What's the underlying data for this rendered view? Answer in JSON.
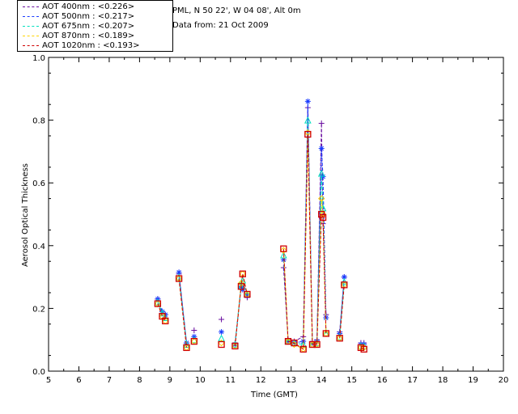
{
  "header": {
    "location": "PML, N 50 22', W 04 08', Alt 0m",
    "date": "Data from: 21 Oct 2009"
  },
  "legend": [
    {
      "label": "AOT  400nm : <0.226>",
      "color": "#6a0fa0"
    },
    {
      "label": "AOT  500nm : <0.217>",
      "color": "#1a3cff"
    },
    {
      "label": "AOT  675nm : <0.207>",
      "color": "#00e0c0"
    },
    {
      "label": "AOT  870nm : <0.189>",
      "color": "#ffd400"
    },
    {
      "label": "AOT 1020nm : <0.193>",
      "color": "#d00000"
    }
  ],
  "chart_data": {
    "type": "line",
    "xlabel": "Time (GMT)",
    "ylabel": "Aerosol Optical Thickness",
    "xlim": [
      5,
      20
    ],
    "ylim": [
      0.0,
      1.0
    ],
    "x_ticks": [
      "5",
      "6",
      "7",
      "8",
      "9",
      "10",
      "11",
      "12",
      "13",
      "14",
      "15",
      "16",
      "17",
      "18",
      "19",
      "20"
    ],
    "y_ticks": [
      "0.0",
      "0.2",
      "0.4",
      "0.6",
      "0.8",
      "1.0"
    ],
    "segments": [
      {
        "x": [
          8.6,
          8.75,
          8.85
        ]
      },
      {
        "x": [
          9.3,
          9.55
        ]
      },
      {
        "x": [
          9.8
        ]
      },
      {
        "x": [
          10.7
        ]
      },
      {
        "x": [
          11.15,
          11.35,
          11.4,
          11.55
        ]
      },
      {
        "x": [
          12.75,
          12.9,
          13.1,
          13.4,
          13.55,
          13.7,
          13.85,
          14.0,
          14.05,
          14.15
        ]
      },
      {
        "x": [
          14.6,
          14.75
        ]
      },
      {
        "x": [
          15.3,
          15.4
        ]
      }
    ],
    "series": [
      {
        "name": "AOT  400nm",
        "marker": "plus",
        "values": [
          [
            0.23,
            0.19,
            0.18
          ],
          [
            0.31,
            0.09
          ],
          [
            0.13
          ],
          [
            0.165
          ],
          [
            0.09,
            0.27,
            0.265,
            0.235
          ],
          [
            0.33,
            0.1,
            0.095,
            0.11,
            0.84,
            0.09,
            0.1,
            0.79,
            0.47,
            0.18
          ],
          [
            0.125,
            0.3
          ],
          [
            0.09,
            0.09
          ]
        ]
      },
      {
        "name": "AOT  500nm",
        "marker": "star",
        "values": [
          [
            0.23,
            0.19,
            0.18
          ],
          [
            0.315,
            0.09
          ],
          [
            0.11
          ],
          [
            0.125
          ],
          [
            0.085,
            0.27,
            0.26,
            0.24
          ],
          [
            0.355,
            0.095,
            0.09,
            0.095,
            0.86,
            0.09,
            0.095,
            0.71,
            0.62,
            0.17
          ],
          [
            0.12,
            0.3
          ],
          [
            0.085,
            0.085
          ]
        ]
      },
      {
        "name": "AOT  675nm",
        "marker": "triangle",
        "values": [
          [
            0.22,
            0.185,
            0.17
          ],
          [
            0.3,
            0.085
          ],
          [
            0.1
          ],
          [
            0.105
          ],
          [
            0.085,
            0.27,
            0.29,
            0.245
          ],
          [
            0.37,
            0.095,
            0.09,
            0.085,
            0.8,
            0.085,
            0.09,
            0.63,
            0.52,
            0.12
          ],
          [
            0.11,
            0.285
          ],
          [
            0.08,
            0.08
          ]
        ]
      },
      {
        "name": "AOT  870nm",
        "marker": "diamond",
        "values": [
          [
            0.215,
            0.175,
            0.16
          ],
          [
            0.295,
            0.075
          ],
          [
            0.095
          ],
          [
            0.09
          ],
          [
            0.08,
            0.28,
            0.31,
            0.245
          ],
          [
            0.385,
            0.095,
            0.085,
            0.07,
            0.76,
            0.085,
            0.085,
            0.55,
            0.5,
            0.12
          ],
          [
            0.105,
            0.275
          ],
          [
            0.075,
            0.075
          ]
        ]
      },
      {
        "name": "AOT 1020nm",
        "marker": "square",
        "values": [
          [
            0.215,
            0.175,
            0.16
          ],
          [
            0.295,
            0.075
          ],
          [
            0.095
          ],
          [
            0.085
          ],
          [
            0.08,
            0.27,
            0.31,
            0.245
          ],
          [
            0.39,
            0.095,
            0.09,
            0.07,
            0.755,
            0.085,
            0.085,
            0.5,
            0.49,
            0.12
          ],
          [
            0.105,
            0.275
          ],
          [
            0.075,
            0.07
          ]
        ]
      }
    ]
  }
}
